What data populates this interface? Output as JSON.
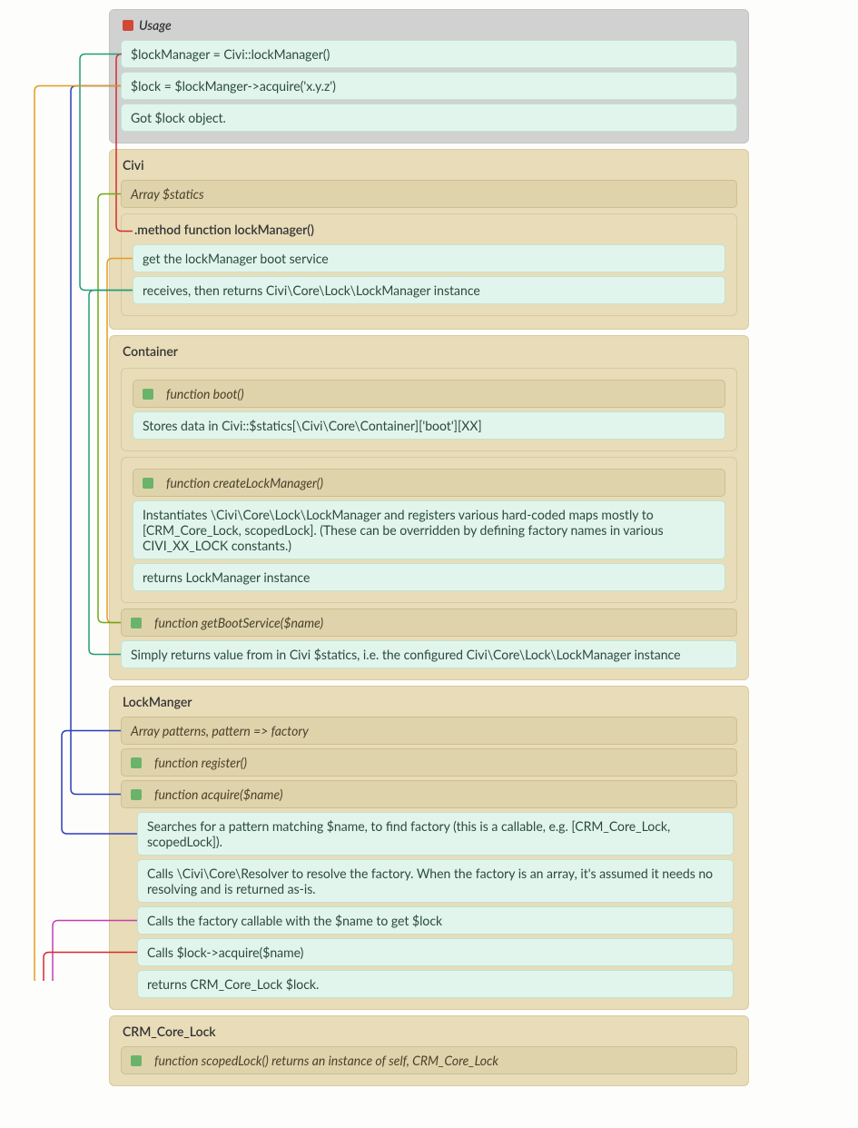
{
  "usage": {
    "title": "Usage",
    "line1": "$lockManager = Civi::lockManager()",
    "line2": "$lock = $lockManger->acquire('x.y.z')",
    "line3": "Got $lock object."
  },
  "civi": {
    "title": "Civi",
    "attr": "Array $statics",
    "method_hdr": ".method function lockManager()",
    "method_l1": "get the lockManager boot service",
    "method_l2": "receives, then returns Civi\\Core\\Lock\\LockManager instance"
  },
  "container": {
    "title": "Container",
    "boot_hdr": "function boot()",
    "boot_l1": "Stores data in Civi::$statics[\\Civi\\Core\\Container]['boot'][XX]",
    "create_hdr": "function createLockManager()",
    "create_l1": "Instantiates \\Civi\\Core\\Lock\\LockManager and registers various hard-coded maps mostly to [CRM_Core_Lock, scopedLock]. (These can be overridden by defining factory names in various CIVI_XX_LOCK constants.)",
    "create_l2": "returns LockManager instance",
    "getbs_hdr": "function getBootService($name)",
    "getbs_l1": "Simply returns value from in Civi $statics, i.e. the configured Civi\\Core\\Lock\\LockManager instance"
  },
  "lockmgr": {
    "title": "LockManger",
    "attr": "Array patterns, pattern => factory",
    "register_hdr": "function register()",
    "acquire_hdr": "function acquire($name)",
    "acquire_l1": "Searches for a pattern matching $name, to find factory (this is a callable, e.g. [CRM_Core_Lock, scopedLock]).",
    "acquire_l2": "Calls \\Civi\\Core\\Resolver to resolve the factory. When the factory is an array, it's assumed it needs no resolving and is returned as-is.",
    "acquire_l3": "Calls the factory callable with the $name to get $lock",
    "acquire_l4": "Calls $lock->acquire($name)",
    "acquire_l5": "returns CRM_Core_Lock $lock."
  },
  "crm": {
    "title": "CRM_Core_Lock",
    "scoped": "function scopedLock() returns an instance of self, CRM_Core_Lock"
  },
  "arrows": [
    {
      "from": "u1",
      "fromSide": "left",
      "to": "civi-method-hdr",
      "toSide": "left",
      "color": "#d62c2c"
    },
    {
      "from": "civi-l1",
      "fromSide": "left",
      "to": "container-getbs-hdr",
      "toSide": "left",
      "color": "#e69b1e"
    },
    {
      "from": "container-getbs-hdr",
      "fromSide": "left",
      "to": "civi-attr",
      "toSide": "left",
      "color": "#70a819"
    },
    {
      "from": "container-getbs-l1",
      "fromSide": "left",
      "to": "civi-l2",
      "toSide": "left",
      "color": "#1f9d7a"
    },
    {
      "from": "civi-l2",
      "fromSide": "left",
      "to": "u1",
      "toSide": "left",
      "color": "#1f9d7a"
    },
    {
      "from": "u2",
      "fromSide": "left",
      "to": "lockmgr-acquire-hdr",
      "toSide": "left",
      "color": "#2b3fb8"
    },
    {
      "from": "lockmgr-acquire-l1",
      "fromSide": "left",
      "to": "lockmgr-attr",
      "toSide": "left",
      "color": "#2b3fb8"
    },
    {
      "from": "lockmgr-acquire-l3",
      "fromSide": "left",
      "to": "crm-scoped",
      "toSide": "left",
      "color": "#c43fb0"
    },
    {
      "from": "crm-scoped",
      "fromSide": "left",
      "to": "lockmgr-acquire-l4",
      "toSide": "left",
      "color": "#d62c2c"
    },
    {
      "from": "lockmgr-acquire-l5",
      "fromSide": "left",
      "to": "u2",
      "toSide": "left",
      "color": "#e69b1e"
    }
  ]
}
